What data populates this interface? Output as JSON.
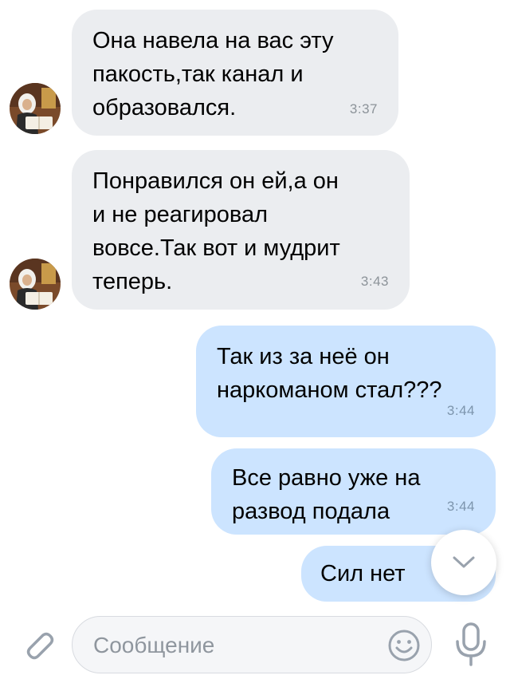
{
  "messages": [
    {
      "direction": "incoming",
      "text": "Она навела на вас эту\nпакость,так канал и\nобразовался.",
      "time": "3:37"
    },
    {
      "direction": "incoming",
      "text": "Понравился он ей,а он\nи не реагировал\nвовсе.Так вот и мудрит\nтеперь.",
      "time": "3:43"
    },
    {
      "direction": "outgoing",
      "text": "Так из за неё он\nнаркоманом стал???",
      "time": "3:44"
    },
    {
      "direction": "outgoing",
      "text": "Все равно уже на\nразвод подала",
      "time": "3:44"
    },
    {
      "direction": "outgoing",
      "text": "Сил нет",
      "time": ""
    }
  ],
  "composer": {
    "placeholder": "Сообщение",
    "value": ""
  },
  "icons": {
    "attach": "paperclip-icon",
    "emoji": "smiley-icon",
    "mic": "microphone-icon",
    "scroll_down": "chevron-down-icon"
  },
  "colors": {
    "incoming_bubble": "#ebedf0",
    "outgoing_bubble": "#cce4ff",
    "icon": "#99a2ad"
  }
}
